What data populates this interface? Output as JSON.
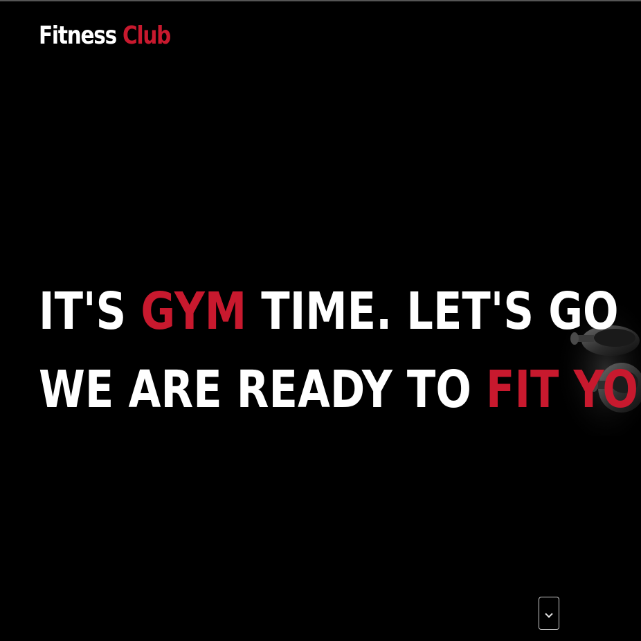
{
  "brand": {
    "name": "Fitness",
    "accent": "Club"
  },
  "hero": {
    "line1_start": "IT'S ",
    "line1_accent": "GYM",
    "line1_end": " TIME. LET'S GO",
    "line2_start": "WE ARE READY TO ",
    "line2_accent": "FIT YOU"
  },
  "scroll": {
    "icon": "chevron-down-icon"
  },
  "colors": {
    "background": "#000000",
    "text": "#ffffff",
    "accent": "#c8192e"
  }
}
